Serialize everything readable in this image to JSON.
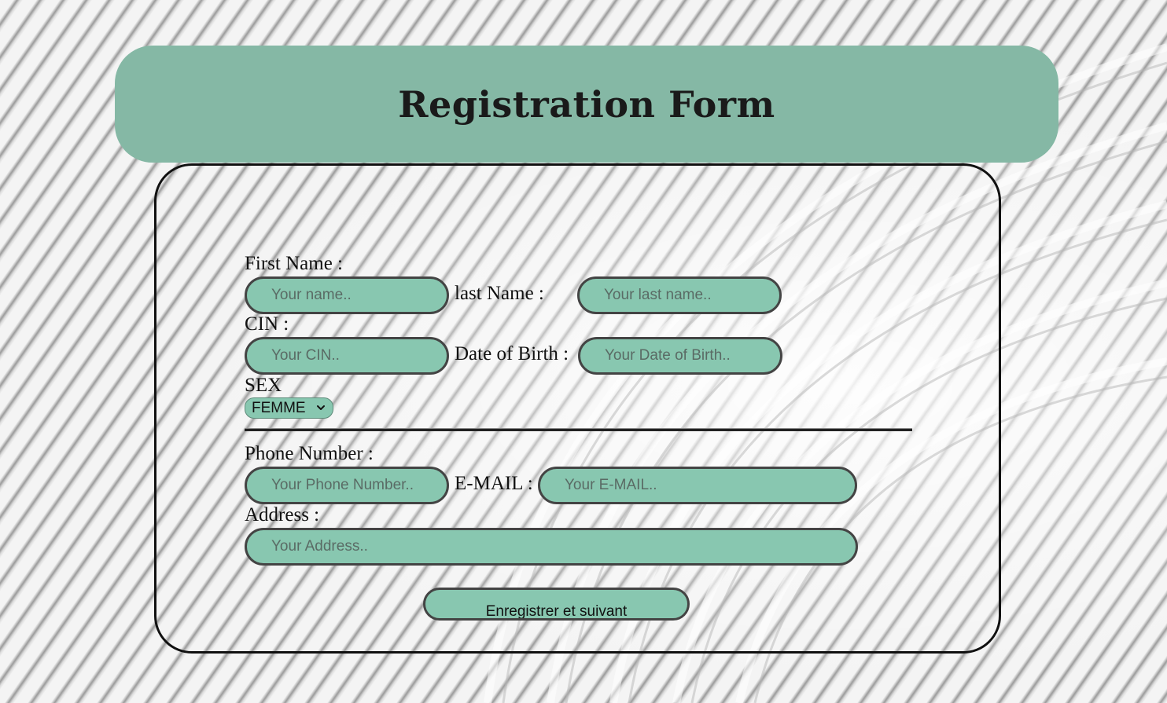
{
  "header": {
    "title": "Registration Form"
  },
  "form": {
    "first_name": {
      "label": "First Name :",
      "placeholder": "Your name.."
    },
    "last_name": {
      "label": "last Name :",
      "placeholder": "Your last name.."
    },
    "cin": {
      "label": "CIN :",
      "placeholder": "Your CIN.."
    },
    "dob": {
      "label": "Date of Birth :",
      "placeholder": "Your Date of Birth.."
    },
    "sex": {
      "label": "SEX",
      "selected": "FEMME"
    },
    "phone": {
      "label": "Phone Number :",
      "placeholder": "Your Phone Number.."
    },
    "email": {
      "label": "E-MAIL :",
      "placeholder": "Your E-MAIL.."
    },
    "address": {
      "label": "Address :",
      "placeholder": "Your Address.."
    },
    "submit_label": "Enregistrer et suivant"
  },
  "colors": {
    "accent": "#85b8a5",
    "field_bg": "#88c7b0",
    "border": "#444444"
  }
}
